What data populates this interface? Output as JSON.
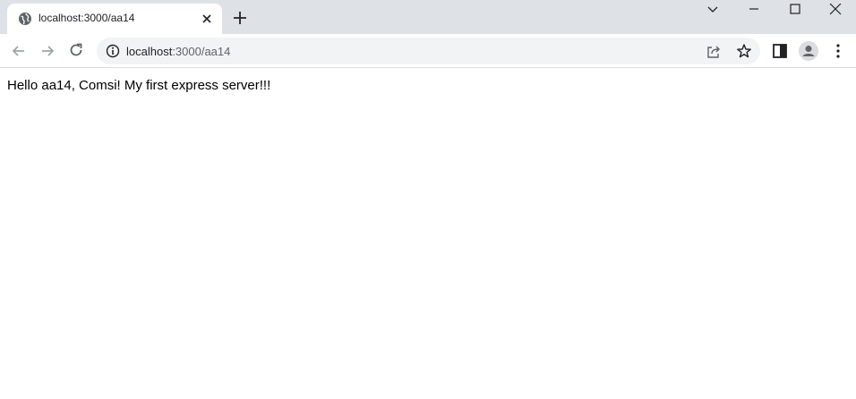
{
  "tab": {
    "title": "localhost:3000/aa14",
    "favicon": "globe-icon"
  },
  "toolbar": {
    "url_host": "localhost",
    "url_path": ":3000/aa14",
    "icons": [
      "back-arrow-icon",
      "forward-arrow-icon",
      "reload-icon",
      "info-icon",
      "share-icon",
      "star-icon",
      "side-panel-icon",
      "profile-icon",
      "more-menu-icon"
    ]
  },
  "window_controls": [
    "tab-search-chevron-icon",
    "minimize-icon",
    "maximize-icon",
    "close-icon"
  ],
  "page": {
    "text": "Hello aa14, Comsi! My first express server!!!"
  },
  "colors": {
    "tabstrip": "#dee1e6",
    "omnibox": "#f1f3f4",
    "icon": "#5f6368",
    "text": "#202124"
  }
}
